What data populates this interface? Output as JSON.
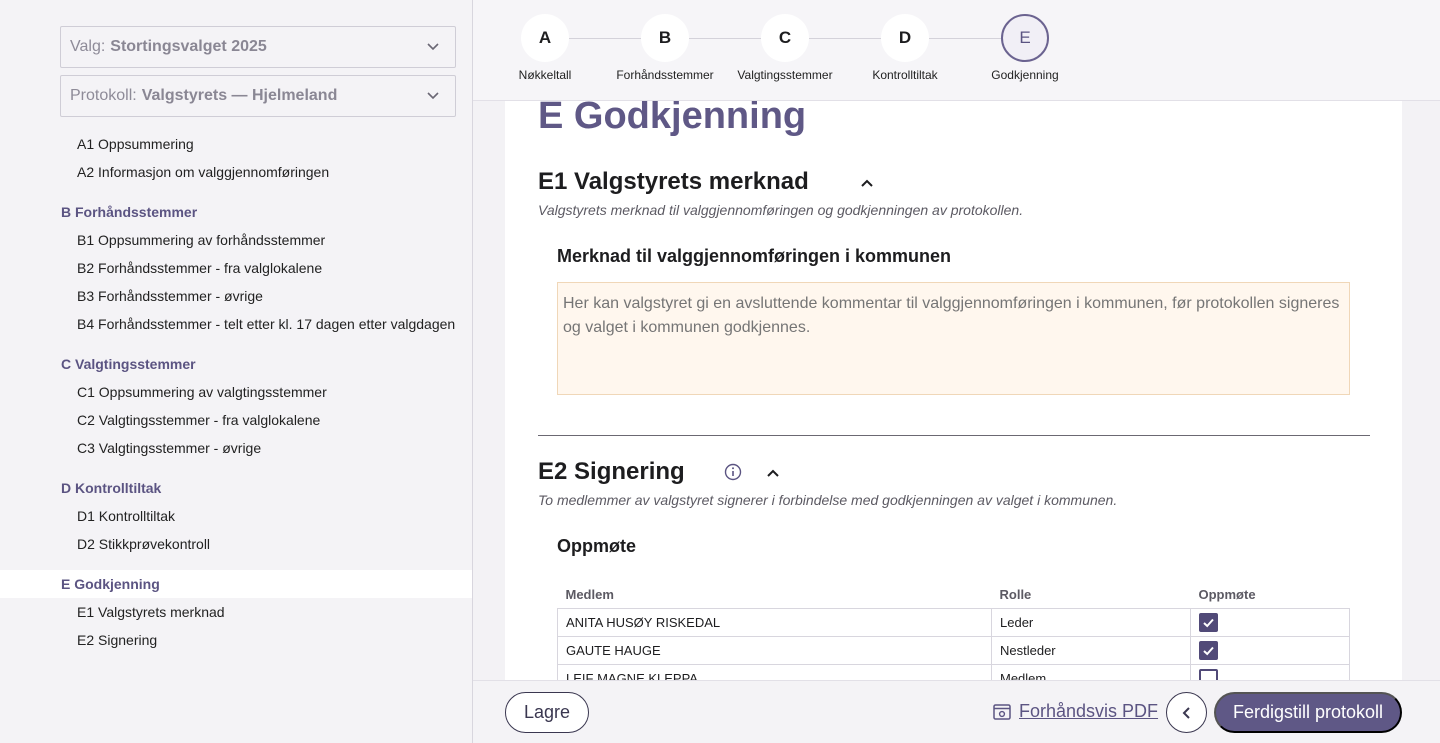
{
  "sidebar": {
    "election_label": "Valg:",
    "election_value": "Stortingsvalget 2025",
    "protocol_label": "Protokoll:",
    "protocol_value": "Valgstyrets — Hjelmeland",
    "nav": [
      {
        "type": "item",
        "label": "A1 Oppsummering"
      },
      {
        "type": "item",
        "label": "A2 Informasjon om valggjennomføringen"
      },
      {
        "type": "group",
        "label": "B Forhåndsstemmer"
      },
      {
        "type": "item",
        "label": "B1 Oppsummering av forhåndsstemmer"
      },
      {
        "type": "item",
        "label": "B2 Forhåndsstemmer - fra valglokalene"
      },
      {
        "type": "item",
        "label": "B3 Forhåndsstemmer - øvrige"
      },
      {
        "type": "item",
        "label": "B4 Forhåndsstemmer - telt etter kl. 17 dagen etter valgdagen"
      },
      {
        "type": "group",
        "label": "C Valgtingsstemmer"
      },
      {
        "type": "item",
        "label": "C1 Oppsummering av valgtingsstemmer"
      },
      {
        "type": "item",
        "label": "C2 Valgtingsstemmer - fra valglokalene"
      },
      {
        "type": "item",
        "label": "C3 Valgtingsstemmer - øvrige"
      },
      {
        "type": "group",
        "label": "D Kontrolltiltak"
      },
      {
        "type": "item",
        "label": "D1 Kontrolltiltak"
      },
      {
        "type": "item",
        "label": "D2 Stikkprøvekontroll"
      },
      {
        "type": "group",
        "label": "E Godkjenning",
        "active": true
      },
      {
        "type": "item",
        "label": "E1 Valgstyrets merknad"
      },
      {
        "type": "item",
        "label": "E2 Signering"
      }
    ]
  },
  "stepper": [
    {
      "letter": "A",
      "label": "Nøkkeltall"
    },
    {
      "letter": "B",
      "label": "Forhåndsstemmer"
    },
    {
      "letter": "C",
      "label": "Valgtingsstemmer"
    },
    {
      "letter": "D",
      "label": "Kontrolltiltak"
    },
    {
      "letter": "E",
      "label": "Godkjenning",
      "current": true
    }
  ],
  "content": {
    "page_title": "E Godkjenning",
    "e1_title": "E1 Valgstyrets merknad",
    "e1_desc": "Valgstyrets merknad til valggjennomføringen og godkjenningen av protokollen.",
    "field_label": "Merknad til valggjennomføringen i kommunen",
    "field_placeholder": "Her kan valgstyret gi en avsluttende kommentar til valggjennomføringen i kommunen, før protokollen signeres og valget i kommunen godkjennes.",
    "field_value": "",
    "e2_title": "E2 Signering",
    "e2_desc": "To medlemmer av valgstyret signerer i forbindelse med godkjenningen av valget i kommunen.",
    "attendance_title": "Oppmøte",
    "table_headers": [
      "Medlem",
      "Rolle",
      "Oppmøte"
    ],
    "members": [
      {
        "name": "ANITA HUSØY RISKEDAL",
        "role": "Leder",
        "present": true
      },
      {
        "name": "GAUTE HAUGE",
        "role": "Nestleder",
        "present": true
      },
      {
        "name": "LEIF MAGNE KLEPPA",
        "role": "Medlem",
        "present": false
      }
    ]
  },
  "footer": {
    "save_label": "Lagre",
    "pdf_label": "Forhåndsvis PDF",
    "finish_label": "Ferdigstill protokoll"
  },
  "colors": {
    "accent": "#5f5886",
    "checkbox": "#514a78",
    "textarea_bg": "#fff7ee"
  },
  "icons": {
    "dropdown": "chevron-down-icon",
    "collapse": "chevron-up-icon",
    "info": "info-icon",
    "pdf": "preview-icon",
    "back": "chevron-left-icon"
  }
}
